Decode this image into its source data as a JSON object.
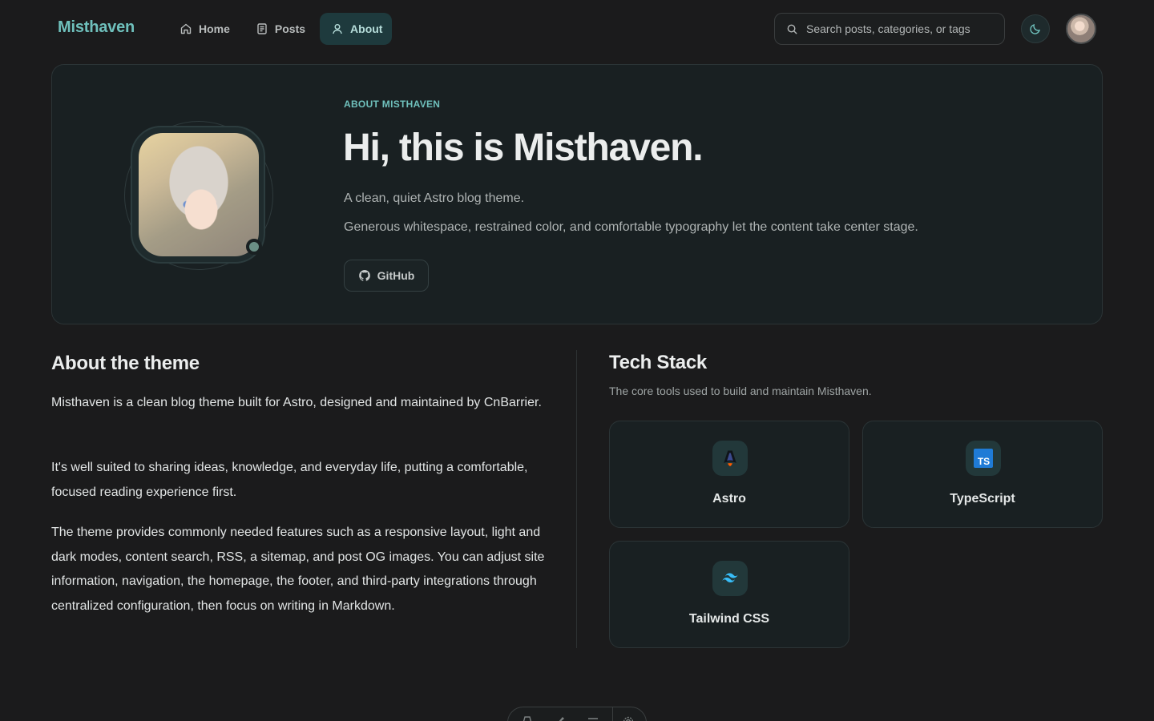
{
  "header": {
    "brand": "Misthaven",
    "nav": [
      {
        "label": "Home",
        "icon": "home-icon",
        "active": false
      },
      {
        "label": "Posts",
        "icon": "document-icon",
        "active": false
      },
      {
        "label": "About",
        "icon": "user-icon",
        "active": true
      }
    ],
    "search_placeholder": "Search posts, categories, or tags",
    "theme_icon": "moon-icon"
  },
  "hero": {
    "eyebrow": "ABOUT MISTHAVEN",
    "title": "Hi, this is Misthaven.",
    "subtitle": "A clean, quiet Astro blog theme.",
    "description": "Generous whitespace, restrained color, and comfortable typography let the content take center stage.",
    "github_label": "GitHub"
  },
  "about": {
    "title": "About the theme",
    "paragraphs": [
      "Misthaven is a clean blog theme built for Astro, designed and maintained by CnBarrier.",
      "It's well suited to sharing ideas, knowledge, and everyday life, putting a comfortable, focused reading experience first.",
      "The theme provides commonly needed features such as a responsive layout, light and dark modes, content search, RSS, a sitemap, and post OG images. You can adjust site information, navigation, the homepage, the footer, and third-party integrations through centralized configuration, then focus on writing in Markdown."
    ]
  },
  "tech": {
    "title": "Tech Stack",
    "subtitle": "The core tools used to build and maintain Misthaven.",
    "items": [
      {
        "name": "Astro",
        "icon": "astro-icon"
      },
      {
        "name": "TypeScript",
        "icon": "typescript-icon"
      },
      {
        "name": "Tailwind CSS",
        "icon": "tailwind-icon"
      }
    ]
  },
  "colors": {
    "accent": "#6fc0bc",
    "background": "#1b1b1c",
    "card": "#192022"
  }
}
